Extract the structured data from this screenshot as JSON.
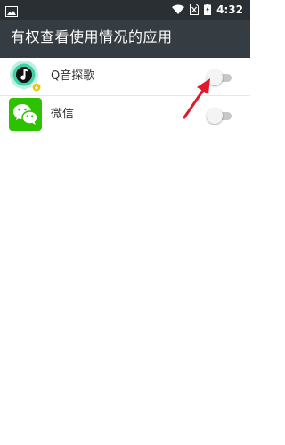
{
  "status_bar": {
    "time": "4:32",
    "icons": [
      "image-icon",
      "wifi-icon",
      "no-sim-icon",
      "battery-charging-icon"
    ]
  },
  "app_bar": {
    "title": "有权查看使用情况的应用"
  },
  "apps": [
    {
      "name": "Q音探歌",
      "icon": "q-music-icon",
      "enabled": false
    },
    {
      "name": "微信",
      "icon": "wechat-icon",
      "enabled": false
    }
  ],
  "colors": {
    "status_bar_bg": "#2a2f33",
    "app_bar_bg": "#353c42",
    "arrow": "#e0192b",
    "wechat_green": "#2dc100",
    "q_music_teal": "#3fd1a7"
  }
}
